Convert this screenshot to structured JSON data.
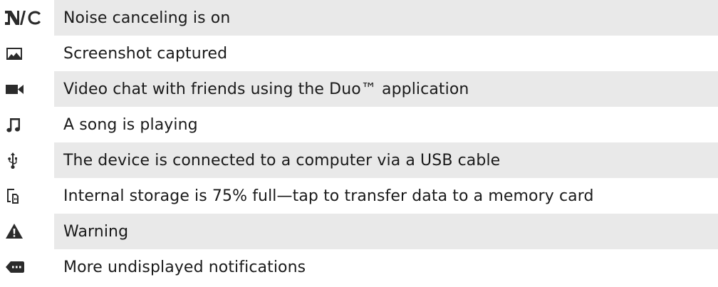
{
  "notifications": [
    {
      "icon": "noise-canceling-icon",
      "label": "Noise canceling is on"
    },
    {
      "icon": "screenshot-icon",
      "label": "Screenshot captured"
    },
    {
      "icon": "video-camera-icon",
      "label": "Video chat with friends using the Duo™ application"
    },
    {
      "icon": "music-note-icon",
      "label": "A song is playing"
    },
    {
      "icon": "usb-icon",
      "label": "The device is connected to a computer via a USB cable"
    },
    {
      "icon": "storage-transfer-icon",
      "label": "Internal storage is 75% full—tap to transfer data to a memory card"
    },
    {
      "icon": "warning-icon",
      "label": "Warning"
    },
    {
      "icon": "more-notifications-icon",
      "label": "More undisplayed notifications"
    }
  ],
  "colors": {
    "row_shade": "#e9e9e9",
    "text": "#1a1a1a",
    "icon": "#2b2b2b"
  }
}
